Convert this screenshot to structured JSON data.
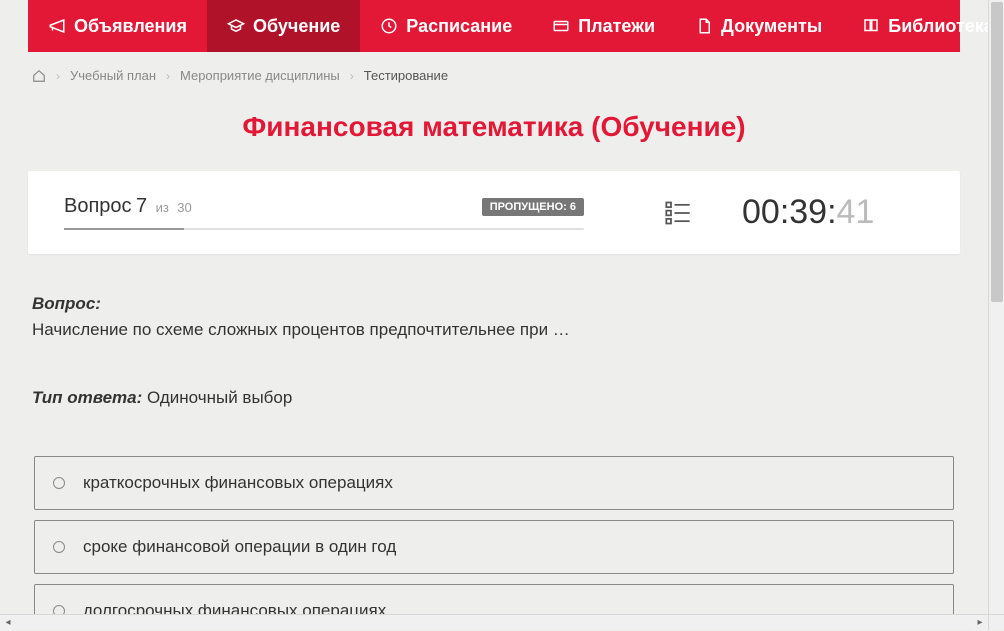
{
  "nav": {
    "items": [
      {
        "label": "Объявления",
        "icon": "megaphone"
      },
      {
        "label": "Обучение",
        "icon": "education",
        "active": true
      },
      {
        "label": "Расписание",
        "icon": "clock"
      },
      {
        "label": "Платежи",
        "icon": "payments"
      },
      {
        "label": "Документы",
        "icon": "document"
      },
      {
        "label": "Библиотека",
        "icon": "library",
        "dropdown": true
      }
    ]
  },
  "breadcrumb": {
    "items": [
      "Учебный план",
      "Мероприятие дисциплины"
    ],
    "current": "Тестирование"
  },
  "page": {
    "title": "Финансовая математика (Обучение)"
  },
  "status": {
    "question_label": "Вопрос",
    "question_number": "7",
    "total_prefix": "из",
    "total": "30",
    "skipped_label": "ПРОПУЩЕНО:",
    "skipped_count": "6",
    "timer_main": "00:39:",
    "timer_ms": "41"
  },
  "question": {
    "label": "Вопрос:",
    "text": "Начисление по схеме сложных процентов предпочтительнее при …",
    "type_label": "Тип ответа:",
    "type_value": "Одиночный выбор"
  },
  "answers": [
    {
      "text": "краткосрочных финансовых операциях"
    },
    {
      "text": "сроке финансовой операции в один год"
    },
    {
      "text": "долгосрочных финансовых операциях"
    }
  ]
}
